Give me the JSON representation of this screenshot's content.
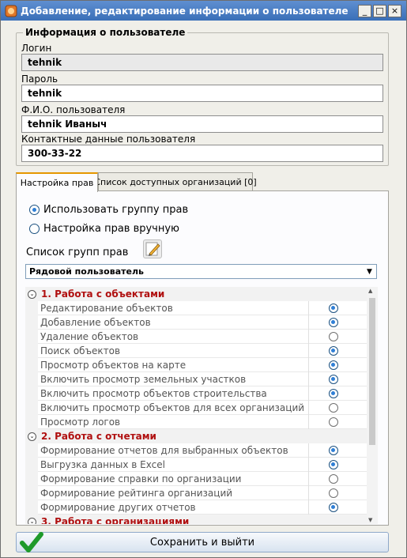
{
  "window": {
    "title": "Добавление, редактирование информации о пользователе",
    "minimize_glyph": "_",
    "maximize_glyph": "□",
    "close_glyph": "×"
  },
  "user_info": {
    "legend": "Информация о пользователе",
    "login_label": "Логин",
    "login_value": "tehnik",
    "password_label": "Пароль",
    "password_value": "tehnik",
    "fullname_label": "Ф.И.О. пользователя",
    "fullname_value": "tehnik Иваныч",
    "contact_label": "Контактные данные пользователя",
    "contact_value": "300-33-22"
  },
  "tabs": [
    {
      "label": "Настройка прав",
      "active": true
    },
    {
      "label": "Список доступных организаций [0]",
      "active": false
    }
  ],
  "rights_mode": {
    "use_group_label": "Использовать группу прав",
    "use_group_selected": true,
    "manual_label": "Настройка прав вручную",
    "manual_selected": false
  },
  "group_list": {
    "label": "Список групп прав",
    "selected": "Рядовой пользователь",
    "arrow_glyph": "▼"
  },
  "rights": {
    "categories": [
      {
        "title": "1. Работа с объектами",
        "items": [
          {
            "label": "Редактирование объектов",
            "checked": true
          },
          {
            "label": "Добавление объектов",
            "checked": true
          },
          {
            "label": "Удаление объектов",
            "checked": false
          },
          {
            "label": "Поиск объектов",
            "checked": true
          },
          {
            "label": "Просмотр объектов на карте",
            "checked": true
          },
          {
            "label": "Включить просмотр земельных участков",
            "checked": true
          },
          {
            "label": "Включить просмотр объектов строительства",
            "checked": true
          },
          {
            "label": "Включить просмотр объектов для всех организаций",
            "checked": false
          },
          {
            "label": "Просмотр логов",
            "checked": false
          }
        ]
      },
      {
        "title": "2. Работа с отчетами",
        "items": [
          {
            "label": "Формирование отчетов для выбранных объектов",
            "checked": true
          },
          {
            "label": "Выгрузка данных в Excel",
            "checked": true
          },
          {
            "label": "Формирование справки по организации",
            "checked": false
          },
          {
            "label": "Формирование рейтинга организаций",
            "checked": false
          },
          {
            "label": "Формирование других отчетов",
            "checked": true
          }
        ]
      },
      {
        "title": "3. Работа с организациями",
        "items": []
      }
    ]
  },
  "footer": {
    "save_label": "Сохранить и выйти"
  },
  "colors": {
    "titlebar": "#3a6fb8",
    "category_text": "#b01010",
    "tab_accent": "#e59700",
    "radio_on": "#2f7fd6",
    "save_check": "#1f9a2a"
  }
}
